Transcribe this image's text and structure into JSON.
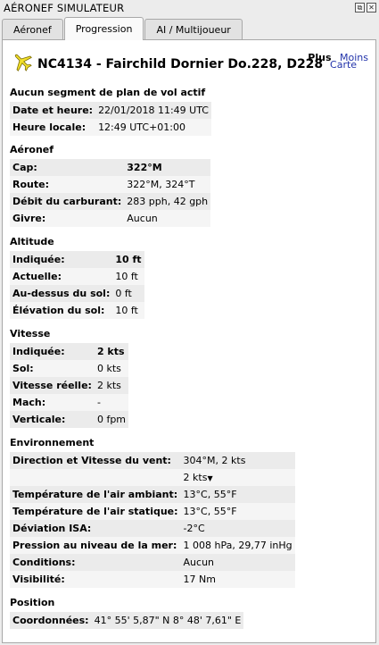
{
  "window": {
    "title": "AÉRONEF SIMULATEUR"
  },
  "tabs": [
    {
      "label": "Aéronef"
    },
    {
      "label": "Progression"
    },
    {
      "label": "AI / Multijoueur"
    }
  ],
  "header": {
    "aircraft": "NC4134 - Fairchild Dornier Do.228, D228",
    "carte_link": "Carte",
    "plus": "Plus",
    "moins": "Moins"
  },
  "flightplan": {
    "heading": "Aucun segment de plan de vol actif",
    "rows": [
      {
        "k": "Date et heure:",
        "v": "22/01/2018 11:49 UTC"
      },
      {
        "k": "Heure locale:",
        "v": "12:49 UTC+01:00"
      }
    ]
  },
  "aeronef": {
    "heading": "Aéronef",
    "rows": [
      {
        "k": "Cap:",
        "v": "322°M"
      },
      {
        "k": "Route:",
        "v": "322°M, 324°T"
      },
      {
        "k": "Débit du carburant:",
        "v": "283 pph, 42 gph"
      },
      {
        "k": "Givre:",
        "v": "Aucun"
      }
    ]
  },
  "altitude": {
    "heading": "Altitude",
    "rows": [
      {
        "k": "Indiquée:",
        "v": "10 ft"
      },
      {
        "k": "Actuelle:",
        "v": "10 ft"
      },
      {
        "k": "Au-dessus du sol:",
        "v": "0 ft"
      },
      {
        "k": "Élévation du sol:",
        "v": "10 ft"
      }
    ]
  },
  "vitesse": {
    "heading": "Vitesse",
    "rows": [
      {
        "k": "Indiquée:",
        "v": "2 kts"
      },
      {
        "k": "Sol:",
        "v": "0 kts"
      },
      {
        "k": "Vitesse réelle:",
        "v": "2 kts"
      },
      {
        "k": "Mach:",
        "v": "-"
      },
      {
        "k": "Verticale:",
        "v": "0 fpm"
      }
    ]
  },
  "environnement": {
    "heading": "Environnement",
    "rows": [
      {
        "k": "Direction et Vitesse du vent:",
        "v": "304°M, 2 kts"
      },
      {
        "k": "",
        "v": "2 kts"
      },
      {
        "k": "Température de l'air ambiant:",
        "v": "13°C, 55°F"
      },
      {
        "k": "Température de l'air statique:",
        "v": "13°C, 55°F"
      },
      {
        "k": "Déviation ISA:",
        "v": "-2°C"
      },
      {
        "k": "Pression au niveau de la mer:",
        "v": "1 008 hPa, 29,77 inHg"
      },
      {
        "k": "Conditions:",
        "v": "Aucun"
      },
      {
        "k": "Visibilité:",
        "v": "17 Nm"
      }
    ]
  },
  "position": {
    "heading": "Position",
    "rows": [
      {
        "k": "Coordonnées:",
        "v": "41° 55' 5,87\" N 8° 48' 7,61\" E"
      }
    ]
  }
}
